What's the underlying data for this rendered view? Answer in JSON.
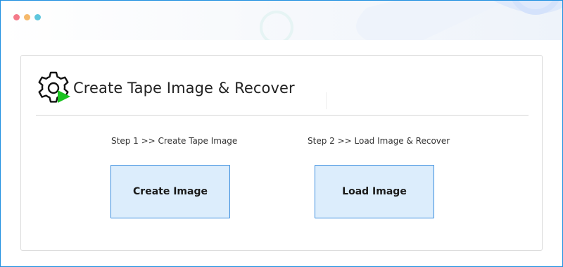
{
  "window": {
    "traffic_lights": [
      "#f47a8a",
      "#f5b86b",
      "#5ec6dd"
    ],
    "accent": "#1e8fe0"
  },
  "header": {
    "icon": "gear-play-icon",
    "title": "Create Tape Image & Recover"
  },
  "steps": [
    {
      "label": "Step 1 >> Create Tape Image",
      "button": "Create Image"
    },
    {
      "label": "Step 2 >> Load Image & Recover",
      "button": "Load Image"
    }
  ],
  "colors": {
    "button_bg": "#dcedfc",
    "button_border": "#3b8ede",
    "play_green": "#19c31f"
  }
}
